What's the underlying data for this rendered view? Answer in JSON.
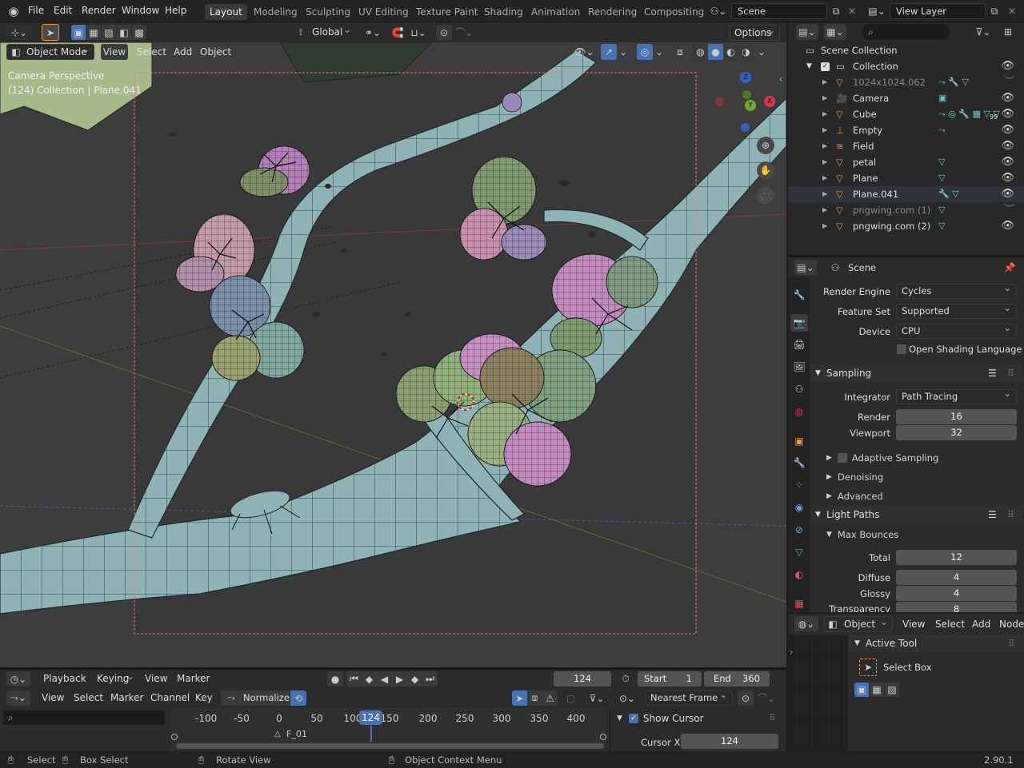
{
  "topbar": {
    "menus": [
      "File",
      "Edit",
      "Render",
      "Window",
      "Help"
    ],
    "workspaces": [
      "Layout",
      "Modeling",
      "Sculpting",
      "UV Editing",
      "Texture Paint",
      "Shading",
      "Animation",
      "Rendering",
      "Compositing"
    ],
    "active_workspace": "Layout",
    "scene": "Scene",
    "view_layer": "View Layer"
  },
  "viewport": {
    "transform_orientation": "Global",
    "options_label": "Options",
    "mode": "Object Mode",
    "menus": [
      "View",
      "Select",
      "Add",
      "Object"
    ],
    "overlay_title": "Camera Perspective",
    "overlay_subtitle": "(124) Collection | Plane.041",
    "gizmo_axes": {
      "z": "Z",
      "y": "Y",
      "x": "X"
    }
  },
  "outliner": {
    "root": "Scene Collection",
    "collection": "Collection",
    "items": [
      {
        "name": "1024x1024.062",
        "dim": true
      },
      {
        "name": "Camera",
        "dim": false
      },
      {
        "name": "Cube",
        "dim": false
      },
      {
        "name": "Empty",
        "dim": false
      },
      {
        "name": "Field",
        "dim": false
      },
      {
        "name": "petal",
        "dim": false
      },
      {
        "name": "Plane",
        "dim": false
      },
      {
        "name": "Plane.041",
        "dim": false
      },
      {
        "name": "pngwing.com (1)",
        "dim": true
      },
      {
        "name": "pngwing.com (2)",
        "dim": false
      }
    ],
    "cube_badge": "99"
  },
  "properties": {
    "context": "Scene",
    "render_engine_label": "Render Engine",
    "render_engine": "Cycles",
    "feature_set_label": "Feature Set",
    "feature_set": "Supported",
    "device_label": "Device",
    "device": "CPU",
    "osl_label": "Open Shading Language",
    "sampling": "Sampling",
    "integrator_label": "Integrator",
    "integrator": "Path Tracing",
    "render_label": "Render",
    "render_samples": "16",
    "viewport_label": "Viewport",
    "viewport_samples": "32",
    "adaptive_sampling": "Adaptive Sampling",
    "denoising": "Denoising",
    "advanced": "Advanced",
    "light_paths": "Light Paths",
    "max_bounces": "Max Bounces",
    "total_label": "Total",
    "total": "12",
    "diffuse_label": "Diffuse",
    "diffuse": "4",
    "glossy_label": "Glossy",
    "glossy": "4",
    "transparency_label": "Transparency",
    "transparency": "8"
  },
  "node_editor": {
    "object_label": "Object",
    "menus": [
      "View",
      "Select",
      "Add",
      "Node"
    ],
    "active_tool": "Active Tool",
    "select_box": "Select Box"
  },
  "timeline": {
    "menus": [
      "Playback",
      "Keying",
      "View",
      "Marker"
    ],
    "current_frame": "124",
    "start_label": "Start",
    "start": "1",
    "end_label": "End",
    "end": "360",
    "graph_menus": [
      "View",
      "Select",
      "Marker",
      "Channel",
      "Key"
    ],
    "normalize": "Normalize",
    "snap": "Nearest Frame",
    "ticks": [
      "-100",
      "-50",
      "0",
      "50",
      "100",
      "150",
      "200",
      "250",
      "300",
      "350",
      "400"
    ],
    "marker": "F_01",
    "show_cursor": "Show Cursor",
    "cursor_x_label": "Cursor X",
    "cursor_x": "124"
  },
  "status": {
    "select": "Select",
    "box_select": "Box Select",
    "rotate_view": "Rotate View",
    "context_menu": "Object Context Menu",
    "version": "2.90.1"
  }
}
